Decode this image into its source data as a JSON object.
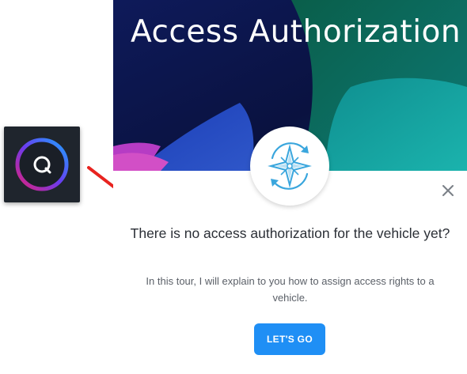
{
  "launcher": {
    "icon": "q-logo-icon"
  },
  "dialog": {
    "banner_title": "Access Authorization",
    "badge_icon": "compass-icon",
    "close_icon": "close-icon",
    "heading": "There is no access authorization for the vehicle yet?",
    "body": "In this tour, I will explain to you how to assign access rights to a vehicle.",
    "primary_button": "LET'S GO"
  },
  "colors": {
    "accent": "#1f8ff5",
    "arrow": "#e8231f",
    "banner_dark": "#0d1a56",
    "banner_teal": "#17a9a6",
    "banner_magenta": "#c03fc8"
  }
}
